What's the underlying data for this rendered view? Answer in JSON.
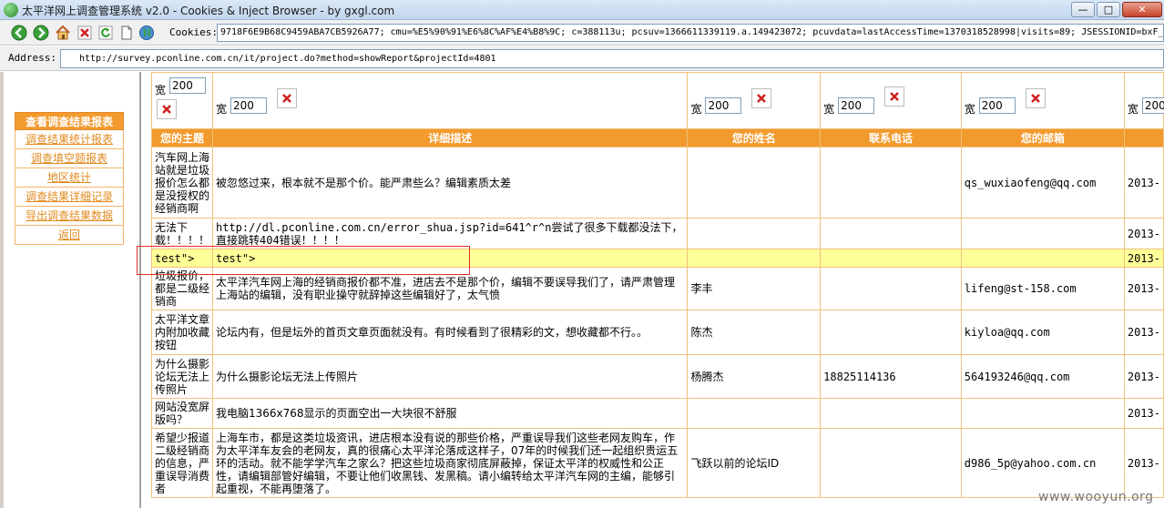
{
  "window": {
    "title": "太平洋网上调查管理系统 v2.0 - Cookies & Inject Browser - by gxgl.com",
    "controls": [
      "minimize",
      "maximize",
      "close"
    ]
  },
  "toolbar": {
    "icons": [
      "back-icon",
      "forward-icon",
      "home-icon",
      "stop-icon",
      "refresh-icon",
      "page-icon",
      "globe-icon"
    ],
    "cookies_label": "Cookies:",
    "cookies_value": "9718F6E9B68C9459ABA7CB5926A77; cmu=%E5%90%91%E6%8C%AF%E4%B8%9C; c=388113u; pcsuv=1366611339119.a.149423072; pcuvdata=lastAccessTime=1370318528998|visits=89; JSESSIONID=bxF_R"
  },
  "address": {
    "label": "Address:",
    "url": "http://survey.pconline.com.cn/it/project.do?method=showReport&projectId=4801"
  },
  "sidebar": {
    "heading": "查看调查结果报表",
    "items": [
      "调查结果统计报表",
      "调查填空题报表",
      "地区统计",
      "调查结果详细记录",
      "导出调查结果数据",
      "返回"
    ]
  },
  "report": {
    "width_label": "宽",
    "width_value": "200",
    "columns": [
      "您的主题",
      "详细描述",
      "您的姓名",
      "联系电话",
      "您的邮箱",
      ""
    ],
    "rows": [
      {
        "subject": "汽车网上海站就是垃圾报价怎么都是没授权的经销商啊",
        "desc": "被忽悠过来，根本就不是那个价。能严肃些么？编辑素质太差",
        "name": "",
        "phone": "",
        "email": "qs_wuxiaofeng@qq.com",
        "date": "2013-"
      },
      {
        "subject": "无法下载！！！！",
        "desc": "http://dl.pconline.com.cn/error_shua.jsp?id=641^r^n尝试了很多下载都没法下，直接跳转404错误！！！！",
        "name": "",
        "phone": "",
        "email": "",
        "date": "2013-"
      },
      {
        "subject": "test\">",
        "desc": "test\">",
        "name": "",
        "phone": "",
        "email": "",
        "date": "2013-"
      },
      {
        "subject": "垃圾报价，都是二级经销商",
        "desc": "太平洋汽车网上海的经销商报价都不准，进店去不是那个价，编辑不要误导我们了，请严肃管理上海站的编辑，没有职业操守就辞掉这些编辑好了，太气愤",
        "name": "李丰",
        "phone": "",
        "email": "lifeng@st-158.com",
        "date": "2013-"
      },
      {
        "subject": "太平洋文章内附加收藏按钮",
        "desc": "论坛内有，但是坛外的首页文章页面就没有。有时候看到了很精彩的文，想收藏都不行。。",
        "name": "陈杰",
        "phone": "",
        "email": "kiyloa@qq.com",
        "date": "2013-"
      },
      {
        "subject": "为什么摄影论坛无法上传照片",
        "desc": "为什么摄影论坛无法上传照片",
        "name": "杨腾杰",
        "phone": "18825114136",
        "email": "564193246@qq.com",
        "date": "2013-"
      },
      {
        "subject": "网站没宽屏版吗？",
        "desc": "我电脑1366x768显示的页面空出一大块很不舒服",
        "name": "",
        "phone": "",
        "email": "",
        "date": "2013-"
      },
      {
        "subject": "希望少报道二级经销商的信息，严重误导消费者",
        "desc": "上海车市，都是这类垃圾资讯，进店根本没有说的那些价格，严重误导我们这些老网友购车，作为太平洋车友会的老网友，真的很痛心太平洋沦落成这样子，07年的时候我们还一起组织贵运五环的活动。就不能学学汽车之家么？把这些垃圾商家彻底屏蔽掉，保证太平洋的权威性和公正性，请编辑部管好编辑，不要让他们收黑钱、发黑稿。请小编转给太平洋汽车网的主编，能够引起重视，不能再堕落了。",
        "name": "飞跃以前的论坛ID",
        "phone": "",
        "email": "d986_5p@yahoo.com.cn",
        "date": "2013-"
      }
    ]
  },
  "watermark": "www.wooyun.org"
}
